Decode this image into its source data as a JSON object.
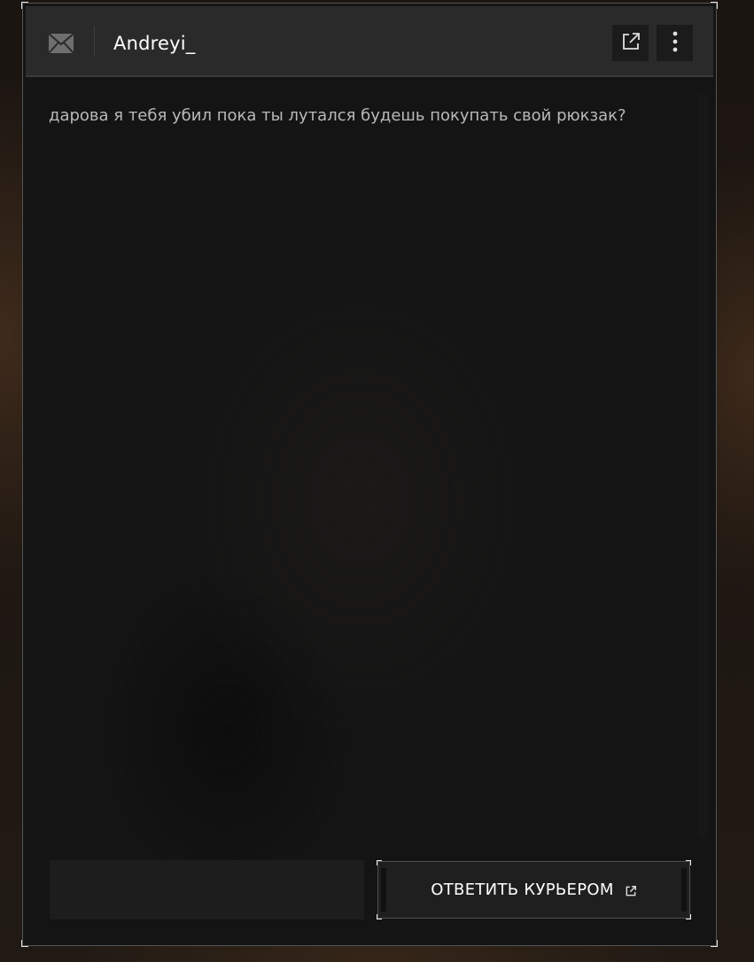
{
  "header": {
    "title": "Andreyi_",
    "icons": {
      "mail": "mail-icon",
      "open_external": "external-link-icon",
      "more": "more-vertical-icon"
    }
  },
  "message": {
    "text": "дарова я тебя убил пока ты лутался будешь покупать свой рюкзак?"
  },
  "reply": {
    "input_value": "",
    "button_label": "ОТВЕТИТЬ КУРЬЕРОМ",
    "button_icon": "external-link-icon"
  },
  "colors": {
    "panel_bg": "#141414",
    "header_bg": "#2a2a2a",
    "text_primary": "#ffffff",
    "text_message": "#b9b9b9",
    "accent_border": "#e6e6e6"
  }
}
